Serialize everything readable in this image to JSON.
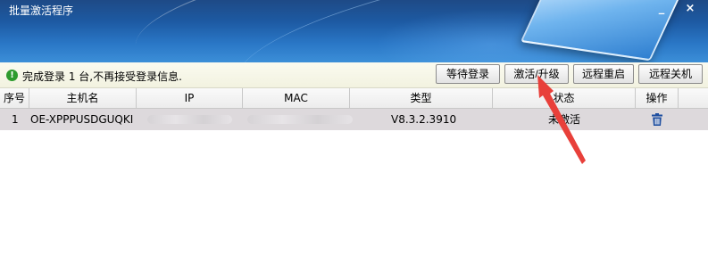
{
  "window": {
    "title": "批量激活程序",
    "minimize_glyph": "_",
    "close_glyph": "×"
  },
  "status": {
    "icon": "ok-check-icon",
    "icon_color": "#2e9b2e",
    "message": "完成登录 1 台,不再接受登录信息."
  },
  "toolbar": {
    "wait_login": "等待登录",
    "activate_upgrade": "激活/升级",
    "remote_restart": "远程重启",
    "remote_shutdown": "远程关机"
  },
  "table": {
    "headers": {
      "index": "序号",
      "hostname": "主机名",
      "ip": "IP",
      "mac": "MAC",
      "type": "类型",
      "status": "状态",
      "action": "操作"
    },
    "rows": [
      {
        "index": "1",
        "hostname": "OE-XPPPUSDGUQKI",
        "ip": "",
        "mac": "",
        "type": "V8.3.2.3910",
        "status": "未激活",
        "action_icon": "trash-icon"
      }
    ]
  },
  "annotation": {
    "arrow_color": "#e8403a"
  }
}
